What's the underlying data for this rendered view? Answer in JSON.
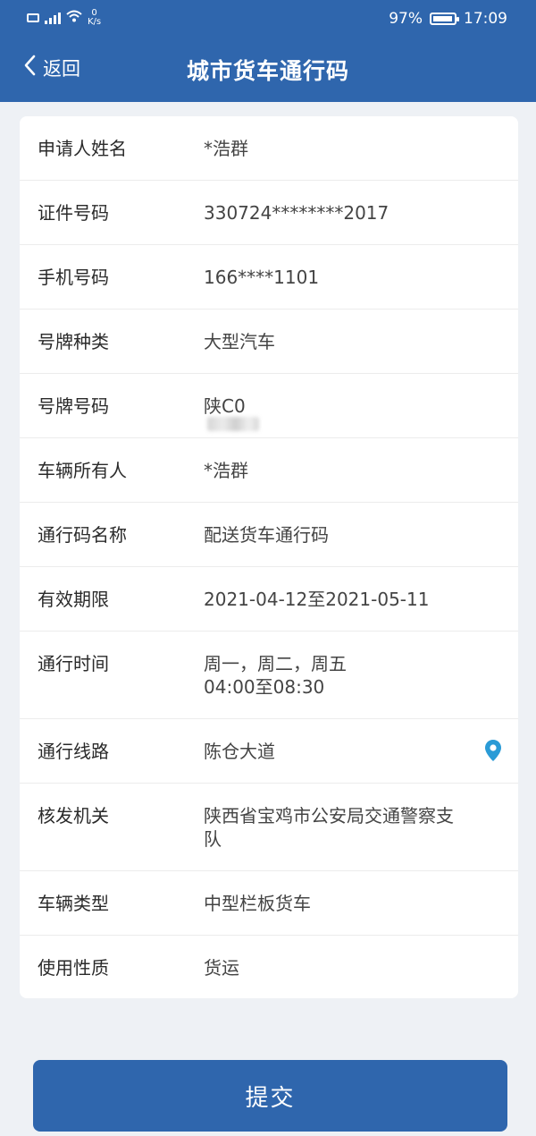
{
  "status_bar": {
    "net_speed_value": "0",
    "net_speed_unit": "K/s",
    "battery_percent": "97%",
    "time": "17:09",
    "battery_level": 0.97
  },
  "nav": {
    "back_label": "返回",
    "title": "城市货车通行码"
  },
  "details": [
    {
      "label": "申请人姓名",
      "value": "*浩群"
    },
    {
      "label": "证件号码",
      "value": "330724********2017"
    },
    {
      "label": "手机号码",
      "value": "166****1101"
    },
    {
      "label": "号牌种类",
      "value": "大型汽车"
    },
    {
      "label": "号牌号码",
      "value": "陕C0"
    },
    {
      "label": "车辆所有人",
      "value": "*浩群"
    },
    {
      "label": "通行码名称",
      "value": "配送货车通行码"
    },
    {
      "label": "有效期限",
      "value": "2021-04-12至2021-05-11"
    },
    {
      "label": "通行时间",
      "value": "周一，周二，周五",
      "value2": "04:00至08:30"
    },
    {
      "label": "通行线路",
      "value": "陈仓大道"
    },
    {
      "label": "核发机关",
      "value": "陕西省宝鸡市公安局交通警察支",
      "value2": "队"
    },
    {
      "label": "车辆类型",
      "value": "中型栏板货车"
    },
    {
      "label": "使用性质",
      "value": "货运"
    }
  ],
  "submit_label": "提交",
  "colors": {
    "primary": "#2f66ad",
    "background": "#eef1f5",
    "location_icon": "#2a9bd6"
  },
  "icons": {
    "back": "chevron-left-icon",
    "location": "location-pin-icon"
  }
}
